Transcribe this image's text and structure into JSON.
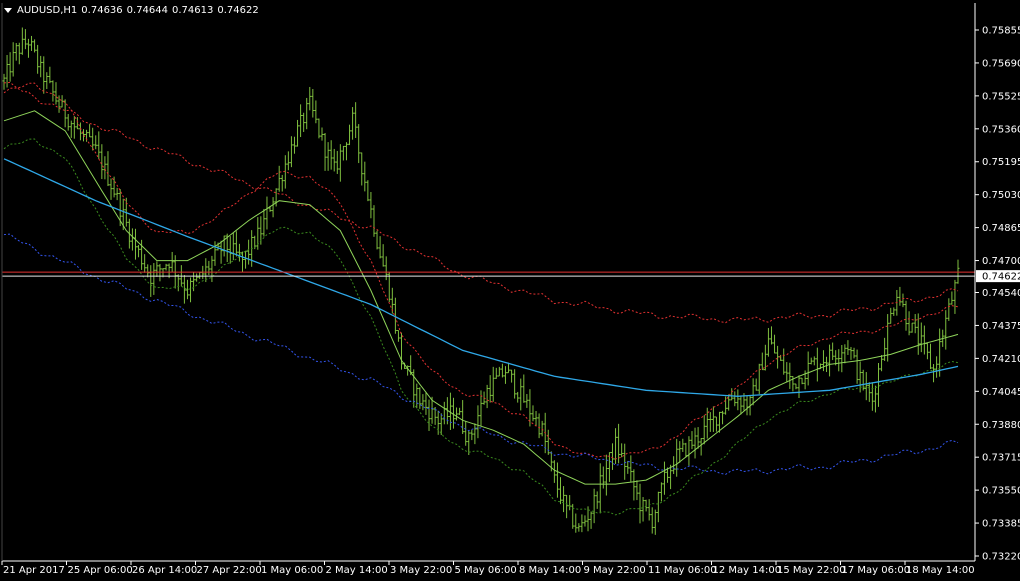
{
  "header": {
    "symbol_timeframe": "AUDUSD,H1",
    "open": "0.74636",
    "high": "0.74644",
    "low": "0.74613",
    "close": "0.74622"
  },
  "price_axis": {
    "labels": [
      "0.75855",
      "0.75690",
      "0.75525",
      "0.75360",
      "0.75195",
      "0.75030",
      "0.74865",
      "0.74700",
      "0.74540",
      "0.74375",
      "0.74210",
      "0.74045",
      "0.73880",
      "0.73715",
      "0.73550",
      "0.73385",
      "0.73220"
    ],
    "current_price_label": "0.74622",
    "min": 0.7322,
    "max": 0.75855
  },
  "time_axis": {
    "labels": [
      "21 Apr 2017",
      "25 Apr 06:00",
      "26 Apr 14:00",
      "27 Apr 22:00",
      "1 May 06:00",
      "2 May 14:00",
      "3 May 22:00",
      "5 May 06:00",
      "8 May 14:00",
      "9 May 22:00",
      "11 May 06:00",
      "12 May 14:00",
      "15 May 22:00",
      "17 May 06:00",
      "18 May 14:00"
    ]
  },
  "colors": {
    "background": "#000000",
    "bar": "#7fbf3f",
    "ma_fast": "#8fd45a",
    "ma_slow": "#2fa8e8",
    "env_fast_upper": "#e23131",
    "env_fast_lower": "#3a8a1e",
    "env_slow_upper": "#e23131",
    "env_slow_lower": "#3355ee",
    "bid_line": "#e23131",
    "ask_line": "#e8e8e8",
    "axis": "#ffffff"
  },
  "chart_data": {
    "type": "ohlc",
    "symbol": "AUDUSD",
    "timeframe": "H1",
    "ylim": [
      0.7322,
      0.75855
    ],
    "close_keypoints": [
      {
        "x": 0,
        "y": 0.756
      },
      {
        "x": 4,
        "y": 0.7575
      },
      {
        "x": 8,
        "y": 0.758
      },
      {
        "x": 12,
        "y": 0.7565
      },
      {
        "x": 18,
        "y": 0.7548
      },
      {
        "x": 24,
        "y": 0.7535
      },
      {
        "x": 30,
        "y": 0.7525
      },
      {
        "x": 36,
        "y": 0.7505
      },
      {
        "x": 42,
        "y": 0.748
      },
      {
        "x": 48,
        "y": 0.7462
      },
      {
        "x": 54,
        "y": 0.747
      },
      {
        "x": 60,
        "y": 0.7455
      },
      {
        "x": 66,
        "y": 0.7465
      },
      {
        "x": 72,
        "y": 0.7478
      },
      {
        "x": 78,
        "y": 0.747
      },
      {
        "x": 84,
        "y": 0.7485
      },
      {
        "x": 90,
        "y": 0.751
      },
      {
        "x": 96,
        "y": 0.7535
      },
      {
        "x": 100,
        "y": 0.7548
      },
      {
        "x": 104,
        "y": 0.753
      },
      {
        "x": 108,
        "y": 0.7515
      },
      {
        "x": 114,
        "y": 0.754
      },
      {
        "x": 118,
        "y": 0.751
      },
      {
        "x": 122,
        "y": 0.748
      },
      {
        "x": 126,
        "y": 0.7455
      },
      {
        "x": 130,
        "y": 0.742
      },
      {
        "x": 136,
        "y": 0.74
      },
      {
        "x": 142,
        "y": 0.739
      },
      {
        "x": 148,
        "y": 0.7395
      },
      {
        "x": 152,
        "y": 0.738
      },
      {
        "x": 158,
        "y": 0.7405
      },
      {
        "x": 164,
        "y": 0.7415
      },
      {
        "x": 170,
        "y": 0.74
      },
      {
        "x": 176,
        "y": 0.7385
      },
      {
        "x": 180,
        "y": 0.736
      },
      {
        "x": 184,
        "y": 0.7345
      },
      {
        "x": 188,
        "y": 0.7335
      },
      {
        "x": 192,
        "y": 0.7345
      },
      {
        "x": 196,
        "y": 0.7362
      },
      {
        "x": 200,
        "y": 0.7378
      },
      {
        "x": 204,
        "y": 0.7365
      },
      {
        "x": 208,
        "y": 0.7348
      },
      {
        "x": 212,
        "y": 0.734
      },
      {
        "x": 216,
        "y": 0.736
      },
      {
        "x": 220,
        "y": 0.7372
      },
      {
        "x": 226,
        "y": 0.738
      },
      {
        "x": 232,
        "y": 0.739
      },
      {
        "x": 238,
        "y": 0.7402
      },
      {
        "x": 244,
        "y": 0.7398
      },
      {
        "x": 250,
        "y": 0.743
      },
      {
        "x": 254,
        "y": 0.7418
      },
      {
        "x": 258,
        "y": 0.7408
      },
      {
        "x": 264,
        "y": 0.7418
      },
      {
        "x": 270,
        "y": 0.7422
      },
      {
        "x": 276,
        "y": 0.7428
      },
      {
        "x": 280,
        "y": 0.741
      },
      {
        "x": 284,
        "y": 0.74
      },
      {
        "x": 288,
        "y": 0.743
      },
      {
        "x": 292,
        "y": 0.7455
      },
      {
        "x": 296,
        "y": 0.7438
      },
      {
        "x": 300,
        "y": 0.7428
      },
      {
        "x": 304,
        "y": 0.7415
      },
      {
        "x": 308,
        "y": 0.744
      },
      {
        "x": 312,
        "y": 0.7462
      }
    ],
    "ma_fast_keypoints": [
      {
        "x": 0,
        "y": 0.754
      },
      {
        "x": 10,
        "y": 0.7545
      },
      {
        "x": 20,
        "y": 0.7535
      },
      {
        "x": 30,
        "y": 0.751
      },
      {
        "x": 40,
        "y": 0.7485
      },
      {
        "x": 50,
        "y": 0.747
      },
      {
        "x": 60,
        "y": 0.747
      },
      {
        "x": 70,
        "y": 0.7478
      },
      {
        "x": 80,
        "y": 0.749
      },
      {
        "x": 90,
        "y": 0.75
      },
      {
        "x": 100,
        "y": 0.7498
      },
      {
        "x": 110,
        "y": 0.7485
      },
      {
        "x": 120,
        "y": 0.7455
      },
      {
        "x": 130,
        "y": 0.742
      },
      {
        "x": 140,
        "y": 0.74
      },
      {
        "x": 150,
        "y": 0.739
      },
      {
        "x": 160,
        "y": 0.7385
      },
      {
        "x": 170,
        "y": 0.7378
      },
      {
        "x": 180,
        "y": 0.7365
      },
      {
        "x": 190,
        "y": 0.7358
      },
      {
        "x": 200,
        "y": 0.7358
      },
      {
        "x": 210,
        "y": 0.736
      },
      {
        "x": 220,
        "y": 0.7368
      },
      {
        "x": 230,
        "y": 0.738
      },
      {
        "x": 240,
        "y": 0.7392
      },
      {
        "x": 250,
        "y": 0.7405
      },
      {
        "x": 260,
        "y": 0.7412
      },
      {
        "x": 270,
        "y": 0.7418
      },
      {
        "x": 280,
        "y": 0.742
      },
      {
        "x": 290,
        "y": 0.7423
      },
      {
        "x": 300,
        "y": 0.7428
      },
      {
        "x": 312,
        "y": 0.7433
      }
    ],
    "ma_slow_keypoints": [
      {
        "x": 0,
        "y": 0.7521
      },
      {
        "x": 30,
        "y": 0.75
      },
      {
        "x": 60,
        "y": 0.7482
      },
      {
        "x": 90,
        "y": 0.7465
      },
      {
        "x": 120,
        "y": 0.7448
      },
      {
        "x": 150,
        "y": 0.7425
      },
      {
        "x": 180,
        "y": 0.7412
      },
      {
        "x": 210,
        "y": 0.7405
      },
      {
        "x": 240,
        "y": 0.7402
      },
      {
        "x": 270,
        "y": 0.7405
      },
      {
        "x": 300,
        "y": 0.7413
      },
      {
        "x": 312,
        "y": 0.7417
      }
    ],
    "envelope_fast_offset": 0.0014,
    "envelope_slow_offset": 0.0038,
    "bid_price": 0.74642,
    "ask_price": 0.74622
  }
}
